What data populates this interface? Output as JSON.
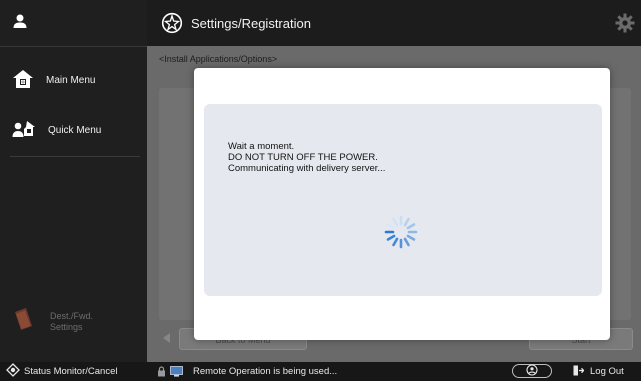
{
  "sidebar": {
    "user_icon": "user-icon",
    "items": [
      {
        "label": "Main Menu",
        "icon": "home-icon"
      },
      {
        "label": "Quick Menu",
        "icon": "quick-menu-icon"
      }
    ],
    "dest": {
      "line1": "Dest./Fwd.",
      "line2": "Settings",
      "icon": "book-icon"
    }
  },
  "header": {
    "title": "Settings/Registration",
    "icon": "settings-registration-icon",
    "right_icon": "gear-icon"
  },
  "content": {
    "breadcrumb": "<Install Applications/Options>",
    "back_label": "Back to Menu",
    "start_label": "Start"
  },
  "dialog": {
    "line1": "Wait a moment.",
    "line2": "DO NOT TURN OFF THE POWER.",
    "line3": "Communicating with delivery server..."
  },
  "statusbar": {
    "status_monitor": "Status Monitor/Cancel",
    "remote": "Remote Operation is being used...",
    "logout": "Log Out"
  },
  "colors": {
    "spinner": "#3a83d8",
    "sidebar_bg": "#1f1f1f",
    "dialog_panel": "#e5e9ef"
  }
}
